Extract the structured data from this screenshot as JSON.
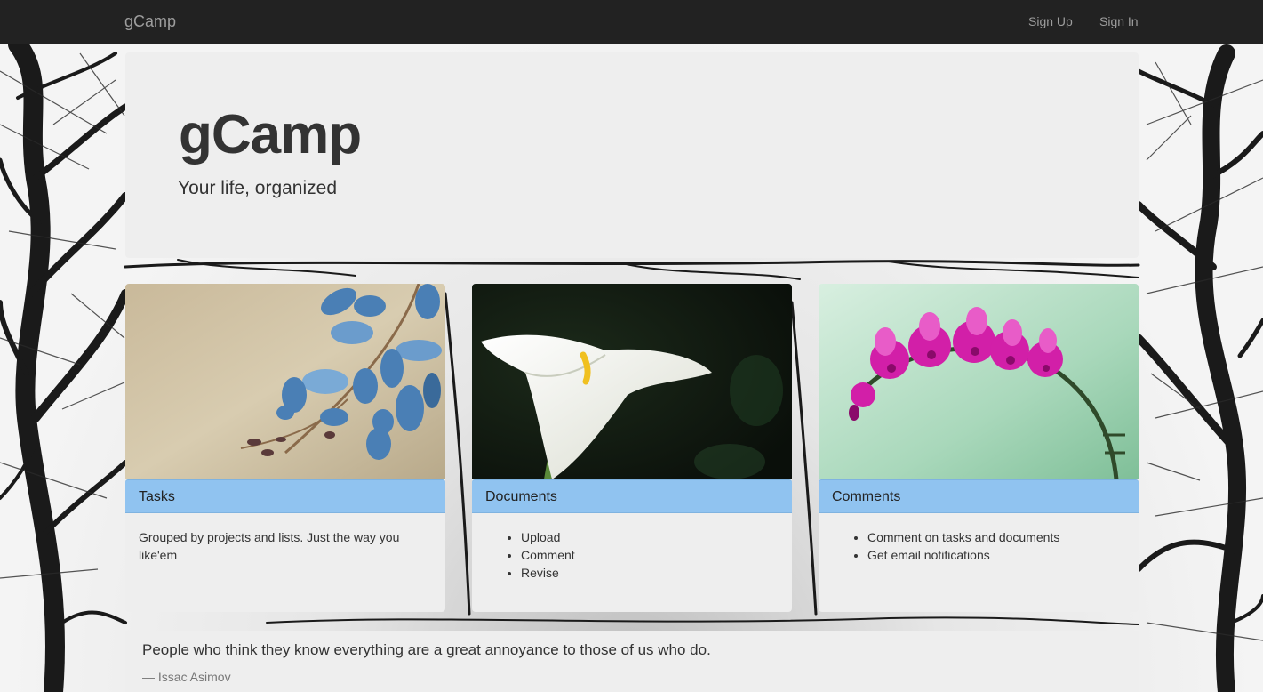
{
  "navbar": {
    "brand": "gCamp",
    "links": [
      "Sign Up",
      "Sign In"
    ]
  },
  "jumbotron": {
    "title": "gCamp",
    "subtitle": "Your life, organized"
  },
  "cards": [
    {
      "heading": "Tasks",
      "image_icon": "blue-flower-image",
      "text": "Grouped by projects and lists. Just the way you like'em"
    },
    {
      "heading": "Documents",
      "image_icon": "calla-lily-image",
      "items": [
        "Upload",
        "Comment",
        "Revise"
      ]
    },
    {
      "heading": "Comments",
      "image_icon": "orchid-image",
      "items": [
        "Comment on tasks and documents",
        "Get email notifications"
      ]
    }
  ],
  "quote": {
    "text": "People who think they know everything are a great annoyance to those of us who do.",
    "author": "— Issac Asimov"
  },
  "colors": {
    "navbar": "#222222",
    "nav_text": "#9d9d9d",
    "panel": "#eeeeee",
    "card_header": "#90c3f0"
  }
}
